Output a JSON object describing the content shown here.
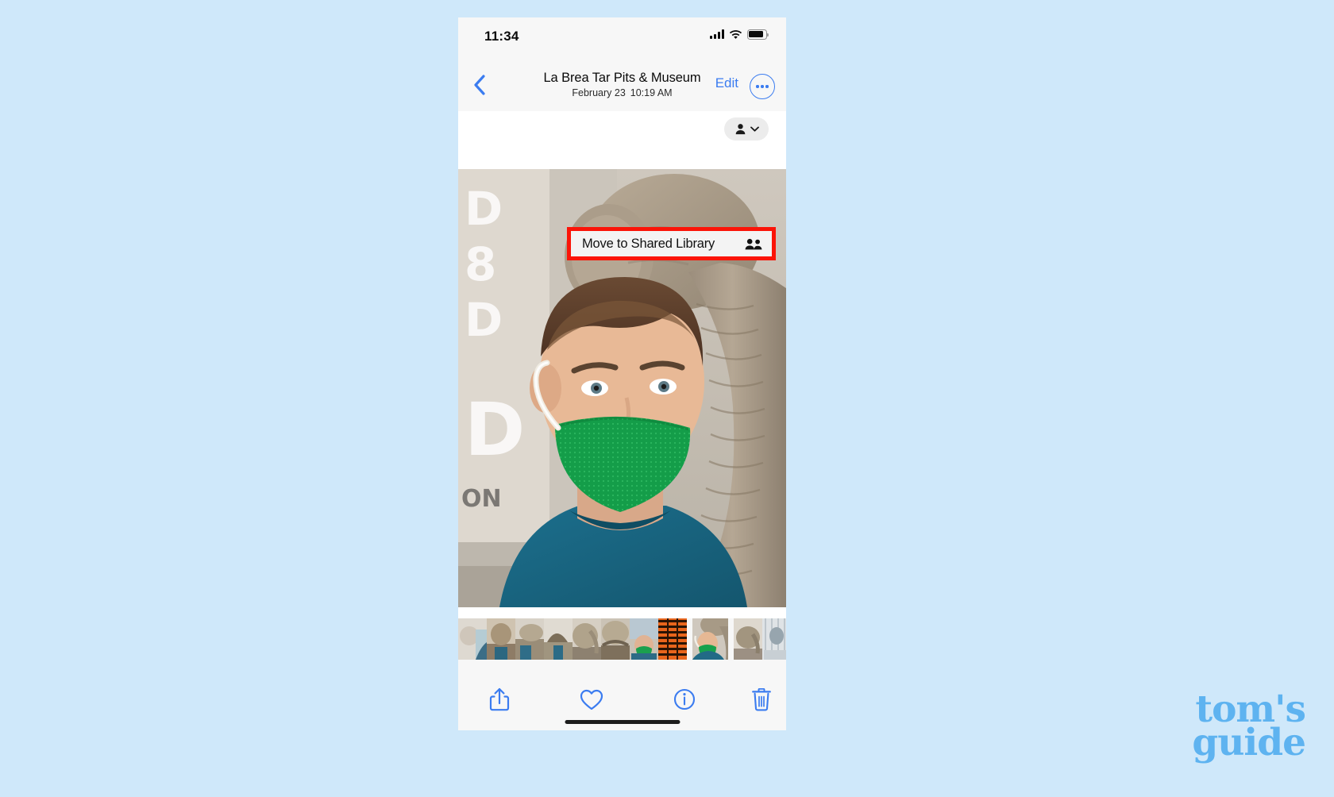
{
  "statusbar": {
    "time": "11:34",
    "cellular_icon": "signal-bars-icon",
    "wifi_icon": "wifi-icon",
    "battery_icon": "battery-icon"
  },
  "navbar": {
    "back_icon": "back-chevron-icon",
    "title": "La Brea Tar Pits & Museum",
    "date": "February 23",
    "time": "10:19 AM",
    "edit_label": "Edit",
    "more_icon": "ellipsis-circle-icon"
  },
  "people_pill": {
    "person_icon": "person-icon",
    "chevron_icon": "chevron-down-icon"
  },
  "callout": {
    "label": "Move to Shared Library",
    "icon": "two-people-icon",
    "highlight_color": "#fb1408"
  },
  "photo": {
    "alt": "Selfie of a man wearing a green face mask in front of a mammoth exhibit"
  },
  "filmstrip": {
    "thumbnails": [
      {
        "name": "thumb-1"
      },
      {
        "name": "thumb-2"
      },
      {
        "name": "thumb-3"
      },
      {
        "name": "thumb-4"
      },
      {
        "name": "thumb-5"
      },
      {
        "name": "thumb-6"
      },
      {
        "name": "thumb-7"
      },
      {
        "name": "thumb-selected"
      },
      {
        "name": "thumb-8"
      },
      {
        "name": "thumb-9"
      },
      {
        "name": "thumb-10"
      },
      {
        "name": "thumb-11"
      },
      {
        "name": "thumb-12"
      }
    ]
  },
  "toolbar": {
    "share_icon": "share-icon",
    "favorite_icon": "heart-icon",
    "info_icon": "info-circle-icon",
    "delete_icon": "trash-icon",
    "accent_color": "#3b7cf0"
  },
  "watermark": {
    "line1": "tom's",
    "line2": "guide",
    "color": "#5eb3f0"
  },
  "background_color": "#cfe8fa"
}
